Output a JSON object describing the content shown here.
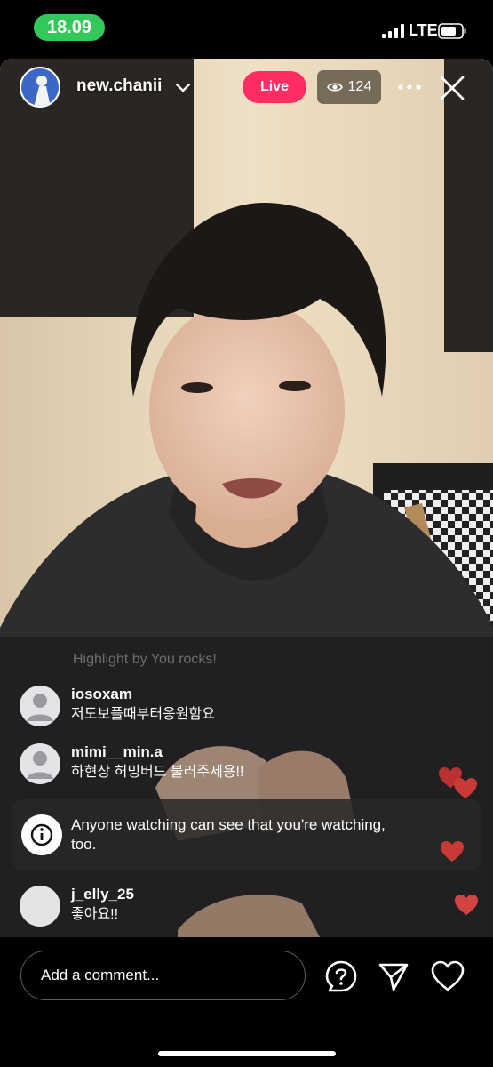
{
  "status_bar": {
    "time": "18.09",
    "network": "LTE",
    "accent_color": "#34c759"
  },
  "header": {
    "host_username": "new.chanii",
    "live_label": "Live",
    "viewer_count": "124",
    "live_color": "#ff2d62"
  },
  "comments": {
    "faded_text": "Highlight by You rocks!",
    "items": [
      {
        "username": "iosoxam",
        "text": "저도보플때부터응원함요"
      },
      {
        "username": "mimi__min.a",
        "text": "하현상 허밍버드 불러주세용!!"
      },
      {
        "username": "j_elly_25",
        "text": "좋아요!!"
      }
    ]
  },
  "notice": {
    "text": "Anyone watching can see that you're watching, too."
  },
  "footer": {
    "comment_placeholder": "Add a comment..."
  },
  "icons": [
    "signal-icon",
    "battery-icon",
    "chevron-down-icon",
    "eye-icon",
    "more-icon",
    "close-icon",
    "info-icon",
    "question-icon",
    "send-icon",
    "heart-icon"
  ]
}
